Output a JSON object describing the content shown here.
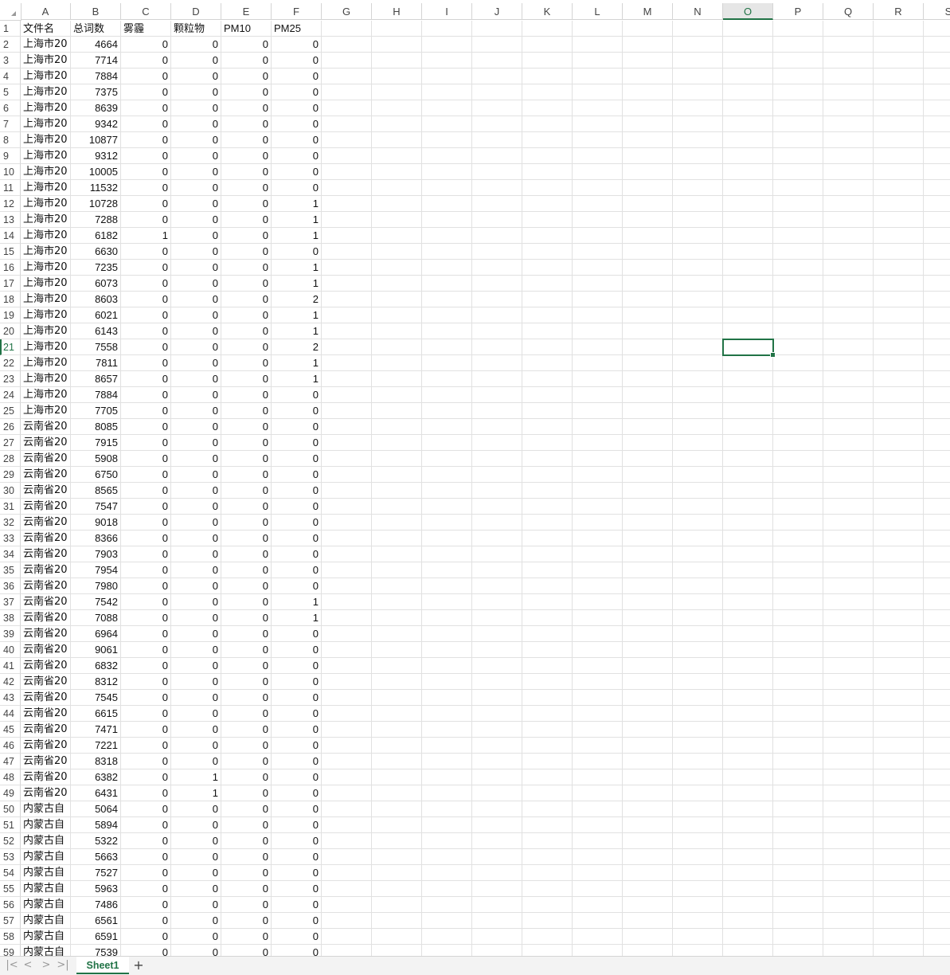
{
  "columns": [
    "A",
    "B",
    "C",
    "D",
    "E",
    "F",
    "G",
    "H",
    "I",
    "J",
    "K",
    "L",
    "M",
    "N",
    "O",
    "P",
    "Q",
    "R",
    "S"
  ],
  "active_column": "O",
  "active_row": 21,
  "header_row": [
    "文件名",
    "总词数",
    "雾霾",
    "颗粒物",
    "PM10",
    "PM25"
  ],
  "rows": [
    [
      "上海市20",
      "4664",
      "0",
      "0",
      "0",
      "0"
    ],
    [
      "上海市20",
      "7714",
      "0",
      "0",
      "0",
      "0"
    ],
    [
      "上海市20",
      "7884",
      "0",
      "0",
      "0",
      "0"
    ],
    [
      "上海市20",
      "7375",
      "0",
      "0",
      "0",
      "0"
    ],
    [
      "上海市20",
      "8639",
      "0",
      "0",
      "0",
      "0"
    ],
    [
      "上海市20",
      "9342",
      "0",
      "0",
      "0",
      "0"
    ],
    [
      "上海市20",
      "10877",
      "0",
      "0",
      "0",
      "0"
    ],
    [
      "上海市20",
      "9312",
      "0",
      "0",
      "0",
      "0"
    ],
    [
      "上海市20",
      "10005",
      "0",
      "0",
      "0",
      "0"
    ],
    [
      "上海市20",
      "11532",
      "0",
      "0",
      "0",
      "0"
    ],
    [
      "上海市20",
      "10728",
      "0",
      "0",
      "0",
      "1"
    ],
    [
      "上海市20",
      "7288",
      "0",
      "0",
      "0",
      "1"
    ],
    [
      "上海市20",
      "6182",
      "1",
      "0",
      "0",
      "1"
    ],
    [
      "上海市20",
      "6630",
      "0",
      "0",
      "0",
      "0"
    ],
    [
      "上海市20",
      "7235",
      "0",
      "0",
      "0",
      "1"
    ],
    [
      "上海市20",
      "6073",
      "0",
      "0",
      "0",
      "1"
    ],
    [
      "上海市20",
      "8603",
      "0",
      "0",
      "0",
      "2"
    ],
    [
      "上海市20",
      "6021",
      "0",
      "0",
      "0",
      "1"
    ],
    [
      "上海市20",
      "6143",
      "0",
      "0",
      "0",
      "1"
    ],
    [
      "上海市20",
      "7558",
      "0",
      "0",
      "0",
      "2"
    ],
    [
      "上海市20",
      "7811",
      "0",
      "0",
      "0",
      "1"
    ],
    [
      "上海市20",
      "8657",
      "0",
      "0",
      "0",
      "1"
    ],
    [
      "上海市20",
      "7884",
      "0",
      "0",
      "0",
      "0"
    ],
    [
      "上海市20",
      "7705",
      "0",
      "0",
      "0",
      "0"
    ],
    [
      "云南省20",
      "8085",
      "0",
      "0",
      "0",
      "0"
    ],
    [
      "云南省20",
      "7915",
      "0",
      "0",
      "0",
      "0"
    ],
    [
      "云南省20",
      "5908",
      "0",
      "0",
      "0",
      "0"
    ],
    [
      "云南省20",
      "6750",
      "0",
      "0",
      "0",
      "0"
    ],
    [
      "云南省20",
      "8565",
      "0",
      "0",
      "0",
      "0"
    ],
    [
      "云南省20",
      "7547",
      "0",
      "0",
      "0",
      "0"
    ],
    [
      "云南省20",
      "9018",
      "0",
      "0",
      "0",
      "0"
    ],
    [
      "云南省20",
      "8366",
      "0",
      "0",
      "0",
      "0"
    ],
    [
      "云南省20",
      "7903",
      "0",
      "0",
      "0",
      "0"
    ],
    [
      "云南省20",
      "7954",
      "0",
      "0",
      "0",
      "0"
    ],
    [
      "云南省20",
      "7980",
      "0",
      "0",
      "0",
      "0"
    ],
    [
      "云南省20",
      "7542",
      "0",
      "0",
      "0",
      "1"
    ],
    [
      "云南省20",
      "7088",
      "0",
      "0",
      "0",
      "1"
    ],
    [
      "云南省20",
      "6964",
      "0",
      "0",
      "0",
      "0"
    ],
    [
      "云南省20",
      "9061",
      "0",
      "0",
      "0",
      "0"
    ],
    [
      "云南省20",
      "6832",
      "0",
      "0",
      "0",
      "0"
    ],
    [
      "云南省20",
      "8312",
      "0",
      "0",
      "0",
      "0"
    ],
    [
      "云南省20",
      "7545",
      "0",
      "0",
      "0",
      "0"
    ],
    [
      "云南省20",
      "6615",
      "0",
      "0",
      "0",
      "0"
    ],
    [
      "云南省20",
      "7471",
      "0",
      "0",
      "0",
      "0"
    ],
    [
      "云南省20",
      "7221",
      "0",
      "0",
      "0",
      "0"
    ],
    [
      "云南省20",
      "8318",
      "0",
      "0",
      "0",
      "0"
    ],
    [
      "云南省20",
      "6382",
      "0",
      "1",
      "0",
      "0"
    ],
    [
      "云南省20",
      "6431",
      "0",
      "1",
      "0",
      "0"
    ],
    [
      "内蒙古自",
      "5064",
      "0",
      "0",
      "0",
      "0"
    ],
    [
      "内蒙古自",
      "5894",
      "0",
      "0",
      "0",
      "0"
    ],
    [
      "内蒙古自",
      "5322",
      "0",
      "0",
      "0",
      "0"
    ],
    [
      "内蒙古自",
      "5663",
      "0",
      "0",
      "0",
      "0"
    ],
    [
      "内蒙古自",
      "7527",
      "0",
      "0",
      "0",
      "0"
    ],
    [
      "内蒙古自",
      "5963",
      "0",
      "0",
      "0",
      "0"
    ],
    [
      "内蒙古自",
      "7486",
      "0",
      "0",
      "0",
      "0"
    ],
    [
      "内蒙古自",
      "6561",
      "0",
      "0",
      "0",
      "0"
    ],
    [
      "内蒙古自",
      "6591",
      "0",
      "0",
      "0",
      "0"
    ],
    [
      "内蒙古自",
      "7539",
      "0",
      "0",
      "0",
      "0"
    ]
  ],
  "sheet_tabs": [
    "Sheet1"
  ],
  "nav": {
    "first": "|<",
    "prev": "<",
    "next": ">",
    "last": ">|",
    "add": "+"
  }
}
